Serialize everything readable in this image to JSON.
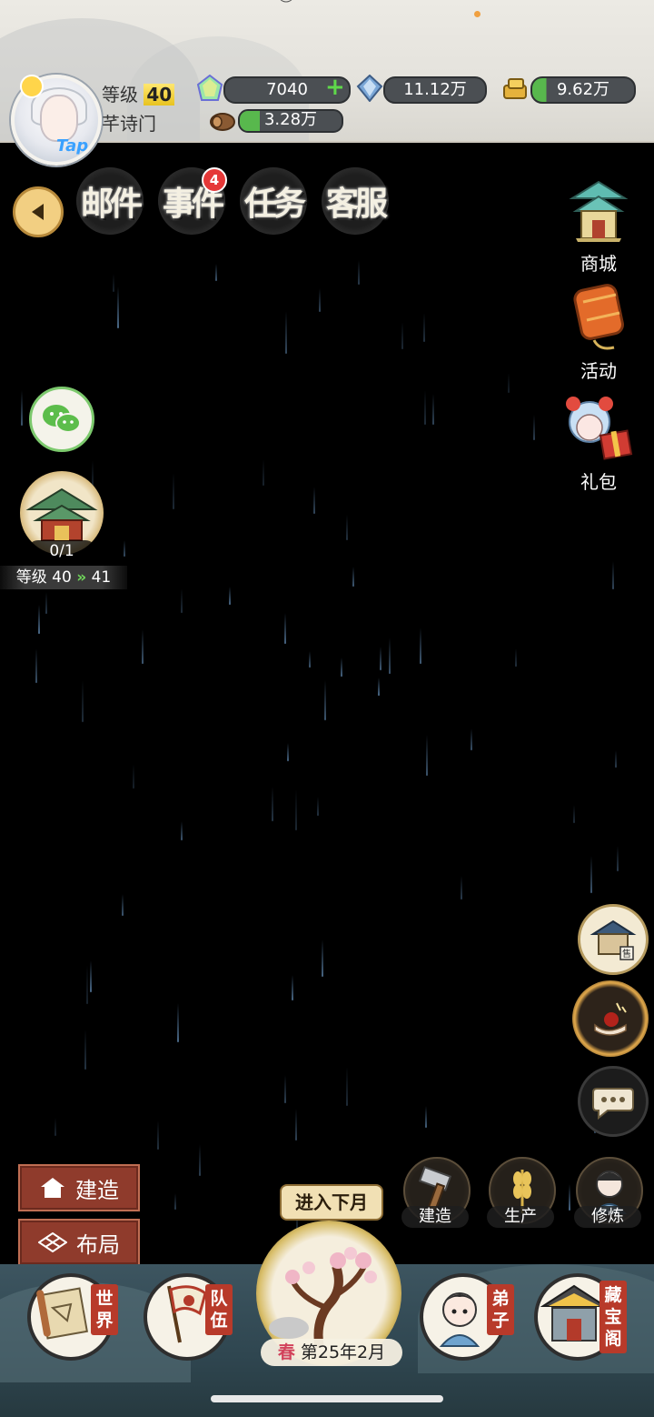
{
  "header": {
    "level_label": "等级",
    "level_value": "40",
    "sect_name": "芊诗门",
    "avatar_badge": "Tap",
    "resources": {
      "jade": "7040",
      "crystal": "11.12万",
      "gold": "9.62万",
      "wood": "3.28万"
    }
  },
  "tabs": [
    {
      "label": "邮件",
      "badge": ""
    },
    {
      "label": "事件",
      "badge": "4"
    },
    {
      "label": "任务",
      "badge": ""
    },
    {
      "label": "客服",
      "badge": ""
    }
  ],
  "side_menu": [
    {
      "label": "商城",
      "icon": "pavilion-icon"
    },
    {
      "label": "活动",
      "icon": "lantern-icon"
    },
    {
      "label": "礼包",
      "icon": "girl-gift-icon"
    }
  ],
  "building": {
    "progress": "0/1",
    "level_label": "等级",
    "level_from": "40",
    "level_to": "41"
  },
  "left_buttons": {
    "build": "建造",
    "layout": "布局"
  },
  "actions": [
    {
      "label": "建造",
      "icon": "hammer-icon"
    },
    {
      "label": "生产",
      "icon": "wheat-icon"
    },
    {
      "label": "修炼",
      "icon": "cultivator-icon"
    }
  ],
  "season": {
    "next_label": "进入下月",
    "season_char": "春",
    "date": "第25年2月"
  },
  "nav": [
    {
      "label": "世界",
      "icon": "scroll-map-icon"
    },
    {
      "label": "队伍",
      "icon": "flag-icon"
    },
    {
      "label": "弟子",
      "icon": "disciple-icon"
    },
    {
      "label": "藏宝阁",
      "icon": "treasure-pavilion-icon"
    }
  ],
  "colors": {
    "accent_gold": "#f2cf82",
    "badge_red": "#e53838",
    "resource_green": "#58b84d",
    "button_red": "#8f3b2c"
  }
}
